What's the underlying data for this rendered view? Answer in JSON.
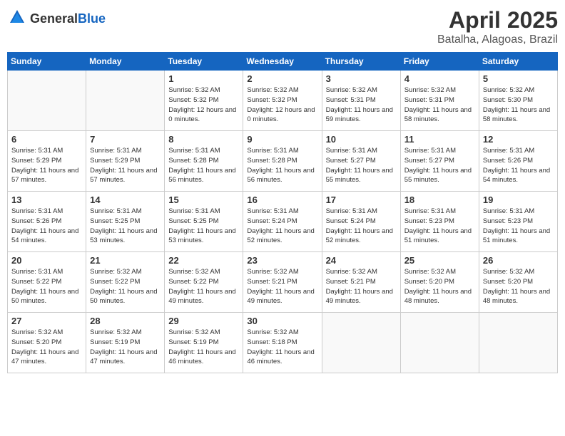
{
  "header": {
    "logo_general": "General",
    "logo_blue": "Blue",
    "month": "April 2025",
    "location": "Batalha, Alagoas, Brazil"
  },
  "days_of_week": [
    "Sunday",
    "Monday",
    "Tuesday",
    "Wednesday",
    "Thursday",
    "Friday",
    "Saturday"
  ],
  "weeks": [
    [
      {
        "day": "",
        "info": ""
      },
      {
        "day": "",
        "info": ""
      },
      {
        "day": "1",
        "info": "Sunrise: 5:32 AM\nSunset: 5:32 PM\nDaylight: 12 hours\nand 0 minutes."
      },
      {
        "day": "2",
        "info": "Sunrise: 5:32 AM\nSunset: 5:32 PM\nDaylight: 12 hours\nand 0 minutes."
      },
      {
        "day": "3",
        "info": "Sunrise: 5:32 AM\nSunset: 5:31 PM\nDaylight: 11 hours\nand 59 minutes."
      },
      {
        "day": "4",
        "info": "Sunrise: 5:32 AM\nSunset: 5:31 PM\nDaylight: 11 hours\nand 58 minutes."
      },
      {
        "day": "5",
        "info": "Sunrise: 5:32 AM\nSunset: 5:30 PM\nDaylight: 11 hours\nand 58 minutes."
      }
    ],
    [
      {
        "day": "6",
        "info": "Sunrise: 5:31 AM\nSunset: 5:29 PM\nDaylight: 11 hours\nand 57 minutes."
      },
      {
        "day": "7",
        "info": "Sunrise: 5:31 AM\nSunset: 5:29 PM\nDaylight: 11 hours\nand 57 minutes."
      },
      {
        "day": "8",
        "info": "Sunrise: 5:31 AM\nSunset: 5:28 PM\nDaylight: 11 hours\nand 56 minutes."
      },
      {
        "day": "9",
        "info": "Sunrise: 5:31 AM\nSunset: 5:28 PM\nDaylight: 11 hours\nand 56 minutes."
      },
      {
        "day": "10",
        "info": "Sunrise: 5:31 AM\nSunset: 5:27 PM\nDaylight: 11 hours\nand 55 minutes."
      },
      {
        "day": "11",
        "info": "Sunrise: 5:31 AM\nSunset: 5:27 PM\nDaylight: 11 hours\nand 55 minutes."
      },
      {
        "day": "12",
        "info": "Sunrise: 5:31 AM\nSunset: 5:26 PM\nDaylight: 11 hours\nand 54 minutes."
      }
    ],
    [
      {
        "day": "13",
        "info": "Sunrise: 5:31 AM\nSunset: 5:26 PM\nDaylight: 11 hours\nand 54 minutes."
      },
      {
        "day": "14",
        "info": "Sunrise: 5:31 AM\nSunset: 5:25 PM\nDaylight: 11 hours\nand 53 minutes."
      },
      {
        "day": "15",
        "info": "Sunrise: 5:31 AM\nSunset: 5:25 PM\nDaylight: 11 hours\nand 53 minutes."
      },
      {
        "day": "16",
        "info": "Sunrise: 5:31 AM\nSunset: 5:24 PM\nDaylight: 11 hours\nand 52 minutes."
      },
      {
        "day": "17",
        "info": "Sunrise: 5:31 AM\nSunset: 5:24 PM\nDaylight: 11 hours\nand 52 minutes."
      },
      {
        "day": "18",
        "info": "Sunrise: 5:31 AM\nSunset: 5:23 PM\nDaylight: 11 hours\nand 51 minutes."
      },
      {
        "day": "19",
        "info": "Sunrise: 5:31 AM\nSunset: 5:23 PM\nDaylight: 11 hours\nand 51 minutes."
      }
    ],
    [
      {
        "day": "20",
        "info": "Sunrise: 5:31 AM\nSunset: 5:22 PM\nDaylight: 11 hours\nand 50 minutes."
      },
      {
        "day": "21",
        "info": "Sunrise: 5:32 AM\nSunset: 5:22 PM\nDaylight: 11 hours\nand 50 minutes."
      },
      {
        "day": "22",
        "info": "Sunrise: 5:32 AM\nSunset: 5:22 PM\nDaylight: 11 hours\nand 49 minutes."
      },
      {
        "day": "23",
        "info": "Sunrise: 5:32 AM\nSunset: 5:21 PM\nDaylight: 11 hours\nand 49 minutes."
      },
      {
        "day": "24",
        "info": "Sunrise: 5:32 AM\nSunset: 5:21 PM\nDaylight: 11 hours\nand 49 minutes."
      },
      {
        "day": "25",
        "info": "Sunrise: 5:32 AM\nSunset: 5:20 PM\nDaylight: 11 hours\nand 48 minutes."
      },
      {
        "day": "26",
        "info": "Sunrise: 5:32 AM\nSunset: 5:20 PM\nDaylight: 11 hours\nand 48 minutes."
      }
    ],
    [
      {
        "day": "27",
        "info": "Sunrise: 5:32 AM\nSunset: 5:20 PM\nDaylight: 11 hours\nand 47 minutes."
      },
      {
        "day": "28",
        "info": "Sunrise: 5:32 AM\nSunset: 5:19 PM\nDaylight: 11 hours\nand 47 minutes."
      },
      {
        "day": "29",
        "info": "Sunrise: 5:32 AM\nSunset: 5:19 PM\nDaylight: 11 hours\nand 46 minutes."
      },
      {
        "day": "30",
        "info": "Sunrise: 5:32 AM\nSunset: 5:18 PM\nDaylight: 11 hours\nand 46 minutes."
      },
      {
        "day": "",
        "info": ""
      },
      {
        "day": "",
        "info": ""
      },
      {
        "day": "",
        "info": ""
      }
    ]
  ]
}
